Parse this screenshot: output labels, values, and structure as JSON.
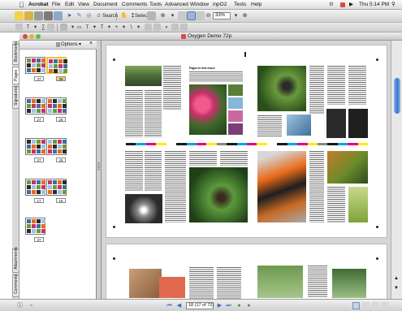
{
  "menubar": {
    "apple_icon": "apple-logo",
    "items": [
      "Acrobat",
      "File",
      "Edit",
      "View",
      "Document",
      "Comments",
      "Tools",
      "Advanced",
      "Window",
      "inpO2",
      "Tests",
      "Help"
    ],
    "clock": "Thu 5:14 PM"
  },
  "toolbar": {
    "search_label": "Search",
    "select_label": "Select",
    "zoom_value": "33%"
  },
  "window": {
    "title": "Oxygen Demo 72p",
    "traffic_colors": [
      "#e0443c",
      "#e6b13a",
      "#5fbf3a"
    ]
  },
  "side_tabs": [
    "Bookmarks",
    "Pages",
    "Signatures",
    "Attachments",
    "Comments"
  ],
  "panel": {
    "options_label": "Options",
    "thumbnails": [
      "37",
      "38",
      "27",
      "28",
      "27",
      "28",
      "17",
      "18",
      "37"
    ]
  },
  "document": {
    "left_page_heading": "Pages in this issue"
  },
  "status": {
    "page_indicator": "18 (17 of 72)"
  },
  "colors": {
    "selection": "#e9c23c",
    "scroll_thumb": "#3a73cf"
  }
}
